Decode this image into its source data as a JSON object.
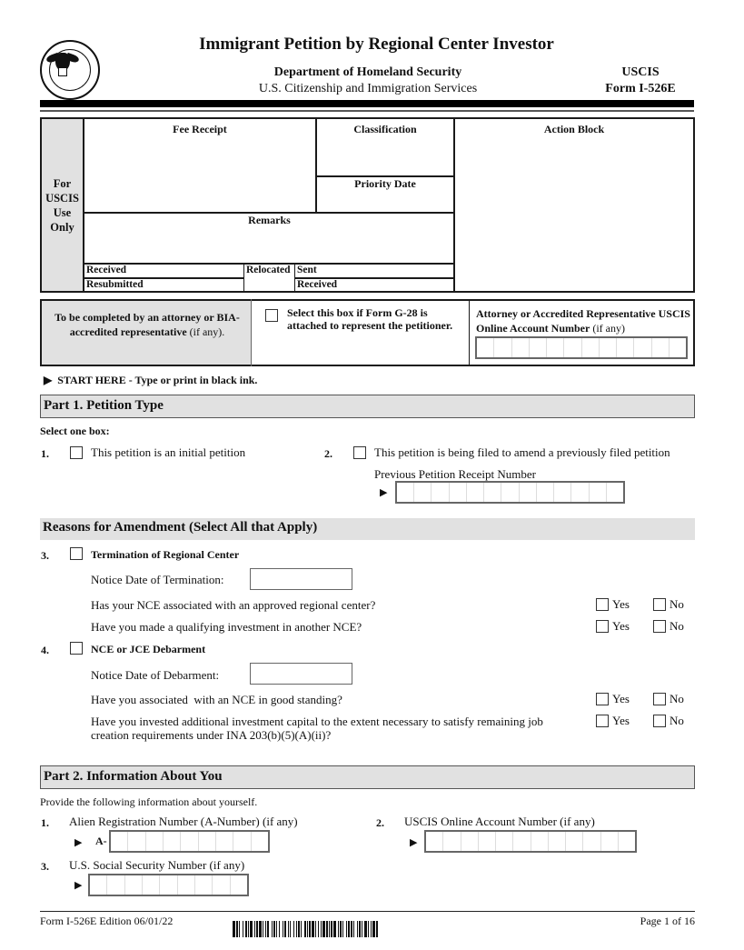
{
  "header": {
    "seal_icon": "dhs-seal-icon",
    "title": "Immigrant Petition by Regional Center Investor",
    "department": "Department of Homeland Security",
    "agency": "U.S. Citizenship and Immigration Services",
    "agency_short": "USCIS",
    "form_number": "Form I-526E"
  },
  "uscis_block": {
    "side_label_lines": [
      "For",
      "USCIS",
      "Use",
      "Only"
    ],
    "fee_receipt": "Fee Receipt",
    "classification": "Classification",
    "priority_date": "Priority Date",
    "action_block": "Action Block",
    "remarks": "Remarks",
    "received": "Received",
    "resubmitted": "Resubmitted",
    "relocated": "Relocated",
    "sent": "Sent",
    "received2": "Received"
  },
  "attorney_block": {
    "left_bold": "To be completed by an attorney or BIA-accredited representative",
    "left_suffix": " (if any).",
    "g28_checkbox_label": "Select this box if Form G-28 is attached to represent the petitioner.",
    "account_label_bold": "Attorney or Accredited Representative USCIS Online Account Number",
    "account_label_suffix": " (if any)",
    "account_cells": 12,
    "account_value": ""
  },
  "start_here": "START HERE - Type or print in black ink.",
  "part1": {
    "heading": "Part 1.  Petition Type",
    "instruction": "Select one box:",
    "items": [
      {
        "number": "1.",
        "label": "This petition is an initial petition",
        "checked": false
      },
      {
        "number": "2.",
        "label": "This petition is being filed to amend a previously filed petition",
        "checked": false
      }
    ],
    "receipt_label": "Previous Petition Receipt Number",
    "receipt_cells": 13,
    "receipt_value": ""
  },
  "amendment": {
    "heading": "Reasons for Amendment (Select All that Apply)",
    "item3": {
      "number": "3.",
      "label": "Termination of Regional Center",
      "checked": false,
      "date_label": "Notice Date of Termination:",
      "date_value": "",
      "questions": [
        {
          "text": "Has your NCE associated with an approved regional center?",
          "yes": "Yes",
          "no": "No"
        },
        {
          "text": "Have you made a qualifying investment in another NCE?",
          "yes": "Yes",
          "no": "No"
        }
      ]
    },
    "item4": {
      "number": "4.",
      "label": "NCE or JCE Debarment",
      "checked": false,
      "date_label": "Notice Date of Debarment:",
      "date_value": "",
      "questions": [
        {
          "text": "Have you associated  with an NCE in good standing?",
          "yes": "Yes",
          "no": "No"
        },
        {
          "text_line1": "Have you invested additional investment capital to the extent necessary to satisfy remaining job",
          "text_line2": "creation requirements under INA 203(b)(5)(A)(ii)?",
          "yes": "Yes",
          "no": "No"
        }
      ]
    }
  },
  "part2": {
    "heading": "Part 2.  Information About You",
    "instruction": "Provide the following information about yourself.",
    "fields": [
      {
        "number": "1.",
        "label": "Alien Registration Number (A-Number) (if any)",
        "prefix": "A-",
        "cells": 9,
        "value": ""
      },
      {
        "number": "2.",
        "label": "USCIS Online Account Number (if any)",
        "cells": 12,
        "value": ""
      },
      {
        "number": "3.",
        "label": "U.S. Social Security Number (if any)",
        "cells": 9,
        "value": ""
      }
    ]
  },
  "footer": {
    "form_edition": "Form I-526E  Edition  06/01/22",
    "page": "Page 1 of 16"
  }
}
